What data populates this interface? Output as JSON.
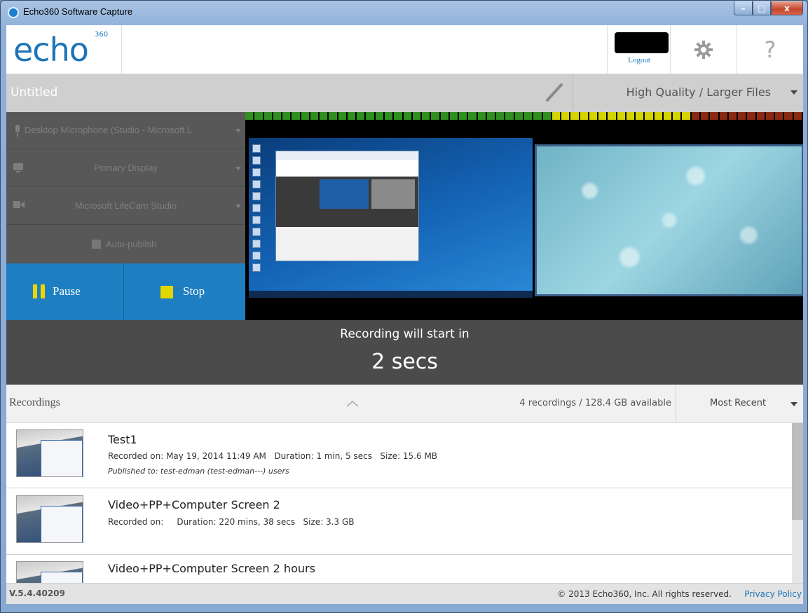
{
  "window": {
    "title": "Echo360 Software Capture",
    "minimize_glyph": "–",
    "maximize_glyph": "□",
    "close_glyph": "x"
  },
  "header": {
    "logo": "echo",
    "logo_superscript": "360",
    "logout_label": "Logout",
    "help_glyph": "?"
  },
  "recording": {
    "title_placeholder": "Untitled",
    "quality": "High Quality / Larger Files"
  },
  "sources": {
    "microphone": "Desktop Microphone (Studio - Microsoft L",
    "display": "Primary Display",
    "camera": "Microsoft LifeCam Studio",
    "auto_publish_label": "Auto-publish"
  },
  "controls": {
    "pause_label": "Pause",
    "stop_label": "Stop"
  },
  "countdown": {
    "label": "Recording will start in",
    "value": "2 secs"
  },
  "recordings": {
    "heading": "Recordings",
    "summary": "4 recordings / 128.4 GB available",
    "sort": "Most Recent",
    "items": [
      {
        "name": "Test1",
        "meta": "Recorded on: May 19, 2014 11:49 AM   Duration: 1 min, 5 secs   Size: 15.6 MB",
        "published": "Published to: test-edman (test-edman---) users"
      },
      {
        "name": "Video+PP+Computer Screen 2",
        "meta": "Recorded on:     Duration: 220 mins, 38 secs   Size: 3.3 GB",
        "published": ""
      },
      {
        "name": "Video+PP+Computer Screen 2 hours",
        "meta": "",
        "published": ""
      }
    ]
  },
  "footer": {
    "version": "V.5.4.40209",
    "copyright": "© 2013 Echo360, Inc. All rights reserved.",
    "privacy_link": "Privacy Policy"
  },
  "colors": {
    "accent_blue": "#1d7fc1",
    "pause_icon_yellow": "#f2d400",
    "meter_green": "#2f8f1f",
    "meter_yellow": "#d6d400",
    "meter_red": "#8a2a12"
  },
  "icons": [
    "microphone-icon",
    "monitor-icon",
    "camera-icon",
    "pencil-icon",
    "gear-icon",
    "help-icon",
    "chevron-up-icon",
    "dropdown-caret-icon"
  ]
}
